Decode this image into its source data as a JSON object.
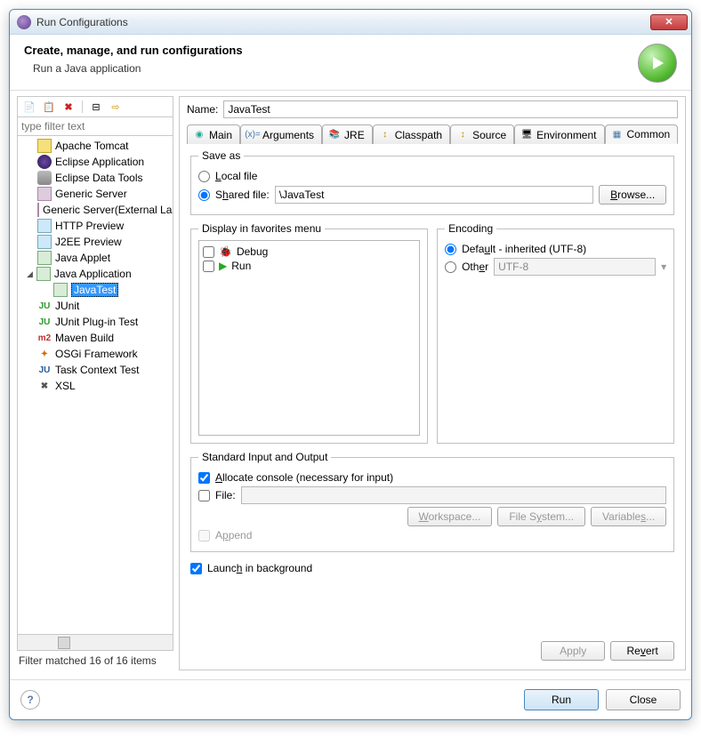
{
  "window": {
    "title": "Run Configurations"
  },
  "header": {
    "title": "Create, manage, and run configurations",
    "subtitle": "Run a Java application"
  },
  "toolbar_icons": {
    "new": "new-icon",
    "dup": "duplicate-icon",
    "delete": "delete-icon",
    "collapse": "collapse-all-icon",
    "filter": "filter-icon"
  },
  "filter": {
    "placeholder": "type filter text"
  },
  "tree": {
    "items": [
      {
        "label": "Apache Tomcat",
        "icon": "tomcat"
      },
      {
        "label": "Eclipse Application",
        "icon": "eclipse"
      },
      {
        "label": "Eclipse Data Tools",
        "icon": "db"
      },
      {
        "label": "Generic Server",
        "icon": "server"
      },
      {
        "label": "Generic Server(External Launch)",
        "icon": "server"
      },
      {
        "label": "HTTP Preview",
        "icon": "http"
      },
      {
        "label": "J2EE Preview",
        "icon": "j2ee"
      },
      {
        "label": "Java Applet",
        "icon": "applet"
      },
      {
        "label": "Java Application",
        "icon": "java",
        "expanded": true
      },
      {
        "label": "JavaTest",
        "icon": "java",
        "child": true,
        "selected": true
      },
      {
        "label": "JUnit",
        "icon": "junit"
      },
      {
        "label": "JUnit Plug-in Test",
        "icon": "junit"
      },
      {
        "label": "Maven Build",
        "icon": "maven"
      },
      {
        "label": "OSGi Framework",
        "icon": "osgi"
      },
      {
        "label": "Task Context Test",
        "icon": "task"
      },
      {
        "label": "XSL",
        "icon": "xsl"
      }
    ]
  },
  "filter_status": "Filter matched 16 of 16 items",
  "name": {
    "label": "Name:",
    "value": "JavaTest"
  },
  "tabs": [
    {
      "label": "Main"
    },
    {
      "label": "Arguments"
    },
    {
      "label": "JRE"
    },
    {
      "label": "Classpath"
    },
    {
      "label": "Source"
    },
    {
      "label": "Environment"
    },
    {
      "label": "Common",
      "active": true
    }
  ],
  "common": {
    "saveas": {
      "legend": "Save as",
      "local": "Local file",
      "shared": "Shared file:",
      "shared_value": "\\JavaTest",
      "browse": "Browse..."
    },
    "favorites": {
      "legend": "Display in favorites menu",
      "items": [
        {
          "label": "Debug"
        },
        {
          "label": "Run"
        }
      ]
    },
    "encoding": {
      "legend": "Encoding",
      "default": "Default - inherited (UTF-8)",
      "other": "Other",
      "other_value": "UTF-8"
    },
    "stdio": {
      "legend": "Standard Input and Output",
      "allocate": "Allocate console (necessary for input)",
      "file": "File:",
      "workspace": "Workspace...",
      "filesystem": "File System...",
      "variables": "Variables...",
      "append": "Append"
    },
    "launch_bg": "Launch in background"
  },
  "buttons": {
    "apply": "Apply",
    "revert": "Revert",
    "run": "Run",
    "close": "Close"
  }
}
